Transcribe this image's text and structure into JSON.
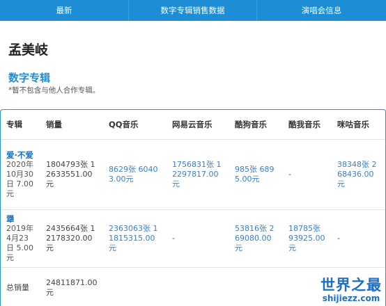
{
  "nav": {
    "items": [
      "最新",
      "数字专辑销售数据",
      "演唱会信息"
    ]
  },
  "artist": "孟美岐",
  "section": {
    "title": "数字专辑",
    "note": "*暂不包含与他人合作专辑。"
  },
  "table": {
    "headers": [
      "专辑",
      "销量",
      "QQ音乐",
      "网易云音乐",
      "酷狗音乐",
      "酷我音乐",
      "咪咕音乐"
    ],
    "rows": [
      {
        "album": "爱·不爱",
        "date": "2020年10月30日 7.00元",
        "sales": "1804793张 12633551.00元",
        "qq": "8629张 60403.00元",
        "netease": "1756831张 12297817.00元",
        "kugou": "985张 6895.00元",
        "kuwo": "-",
        "migu": "38348张 268436.00元"
      },
      {
        "album": "犟",
        "date": "2019年4月23日 5.00元",
        "sales": "2435664张 12178320.00元",
        "qq": "2363063张 11815315.00元",
        "netease": "-",
        "kugou": "53816张 269080.00元",
        "kuwo": "18785张 93925.00元",
        "migu": "-"
      }
    ],
    "total": {
      "label": "总销量",
      "value": "24811871.00元"
    }
  },
  "watermark": {
    "cn": "世界之最",
    "en": "shijiezz.com"
  }
}
